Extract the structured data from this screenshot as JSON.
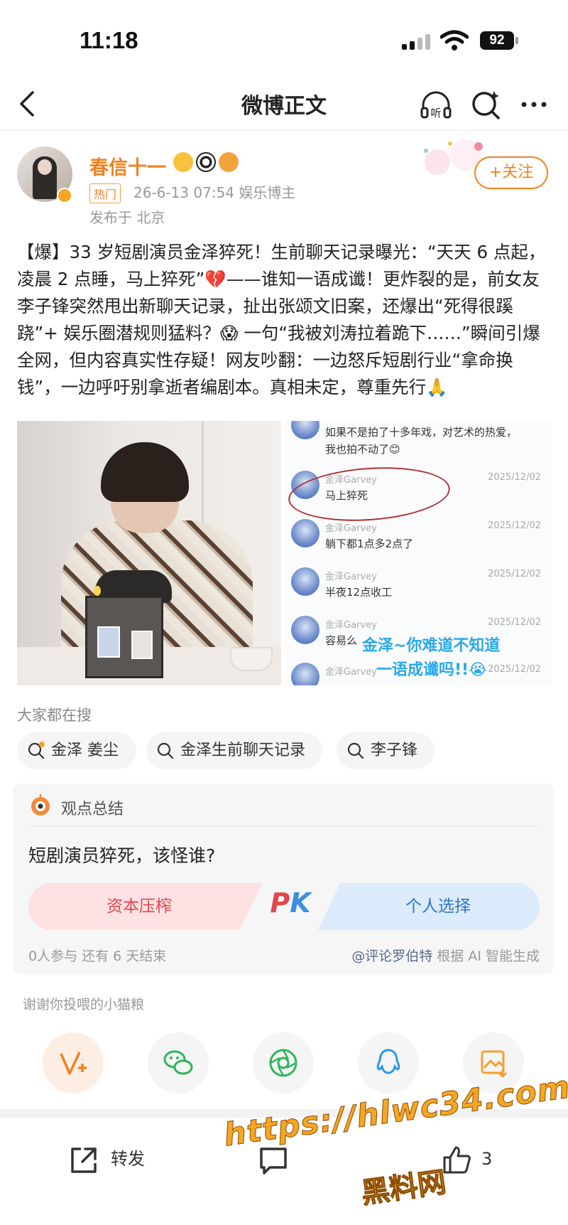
{
  "status": {
    "time": "11:18",
    "battery": "92"
  },
  "nav": {
    "title": "微博正文"
  },
  "author": {
    "name": "春信十一",
    "hot_tag": "热门",
    "meta": "26-6-13 07:54  娱乐博主",
    "location": "发布于 北京",
    "follow_label": "+关注"
  },
  "post": {
    "text": "【爆】33 岁短剧演员金泽猝死！生前聊天记录曝光：“天天 6 点起，凌晨 2 点睡，马上猝死”💔——谁知一语成谶！更炸裂的是，前女友李子锋突然甩出新聊天记录，扯出张颂文旧案，还爆出“死得很蹊跷”+ 娱乐圈潜规则猛料？😱 一句“我被刘涛拉着跪下……”瞬间引爆全网，但内容真实性存疑！网友吵翻：一边怒斥短剧行业“拿命换钱”，一边呼吁别拿逝者编剧本。真相未定，尊重先行🙏"
  },
  "chat": {
    "top_line1": "如果不是拍了十多年戏，对艺术的热爱，",
    "top_line2": "我也拍不动了😊",
    "messages": [
      {
        "name": "金泽Garvey",
        "date": "2025/12/02",
        "text": "马上猝死"
      },
      {
        "name": "金泽Garvey",
        "date": "2025/12/02",
        "text": "躺下都1点多2点了"
      },
      {
        "name": "金泽Garvey",
        "date": "2025/12/02",
        "text": "半夜12点收工"
      },
      {
        "name": "金泽Garvey",
        "date": "2025/12/02",
        "text": "容易么"
      },
      {
        "name": "金泽Garvey",
        "date": "2025/12/02",
        "text": ""
      }
    ],
    "caption_line1": "金泽~你难道不知道",
    "caption_line2": "一语成谶吗!!😭"
  },
  "hot_search": {
    "title": "大家都在搜",
    "items": [
      "金泽 姜尘",
      "金泽生前聊天记录",
      "李子锋"
    ]
  },
  "summary": {
    "title": "观点总结",
    "question": "短剧演员猝死，该怪谁?",
    "left_option": "资本压榨",
    "right_option": "个人选择",
    "pk_p": "P",
    "pk_k": "K",
    "participants": "0人参与  还有 6 天结束",
    "credit_link": "@评论罗伯特",
    "credit_text": " 根据 AI 智能生成"
  },
  "share": {
    "thanks": "谢谢你投喂的小猫粮",
    "icons": [
      "vplus-icon",
      "wechat-icon",
      "moments-icon",
      "qq-icon",
      "save-image-icon"
    ]
  },
  "bottom_bar": {
    "repost_label": "转发",
    "like_count": "3"
  },
  "watermark": {
    "url": "https://hlwc34.com",
    "name": "黑料网"
  },
  "colors": {
    "accent_orange": "#f0821e",
    "pk_red": "#e2474d",
    "pk_blue": "#2f76c8",
    "caption_blue": "#29a9e8"
  }
}
